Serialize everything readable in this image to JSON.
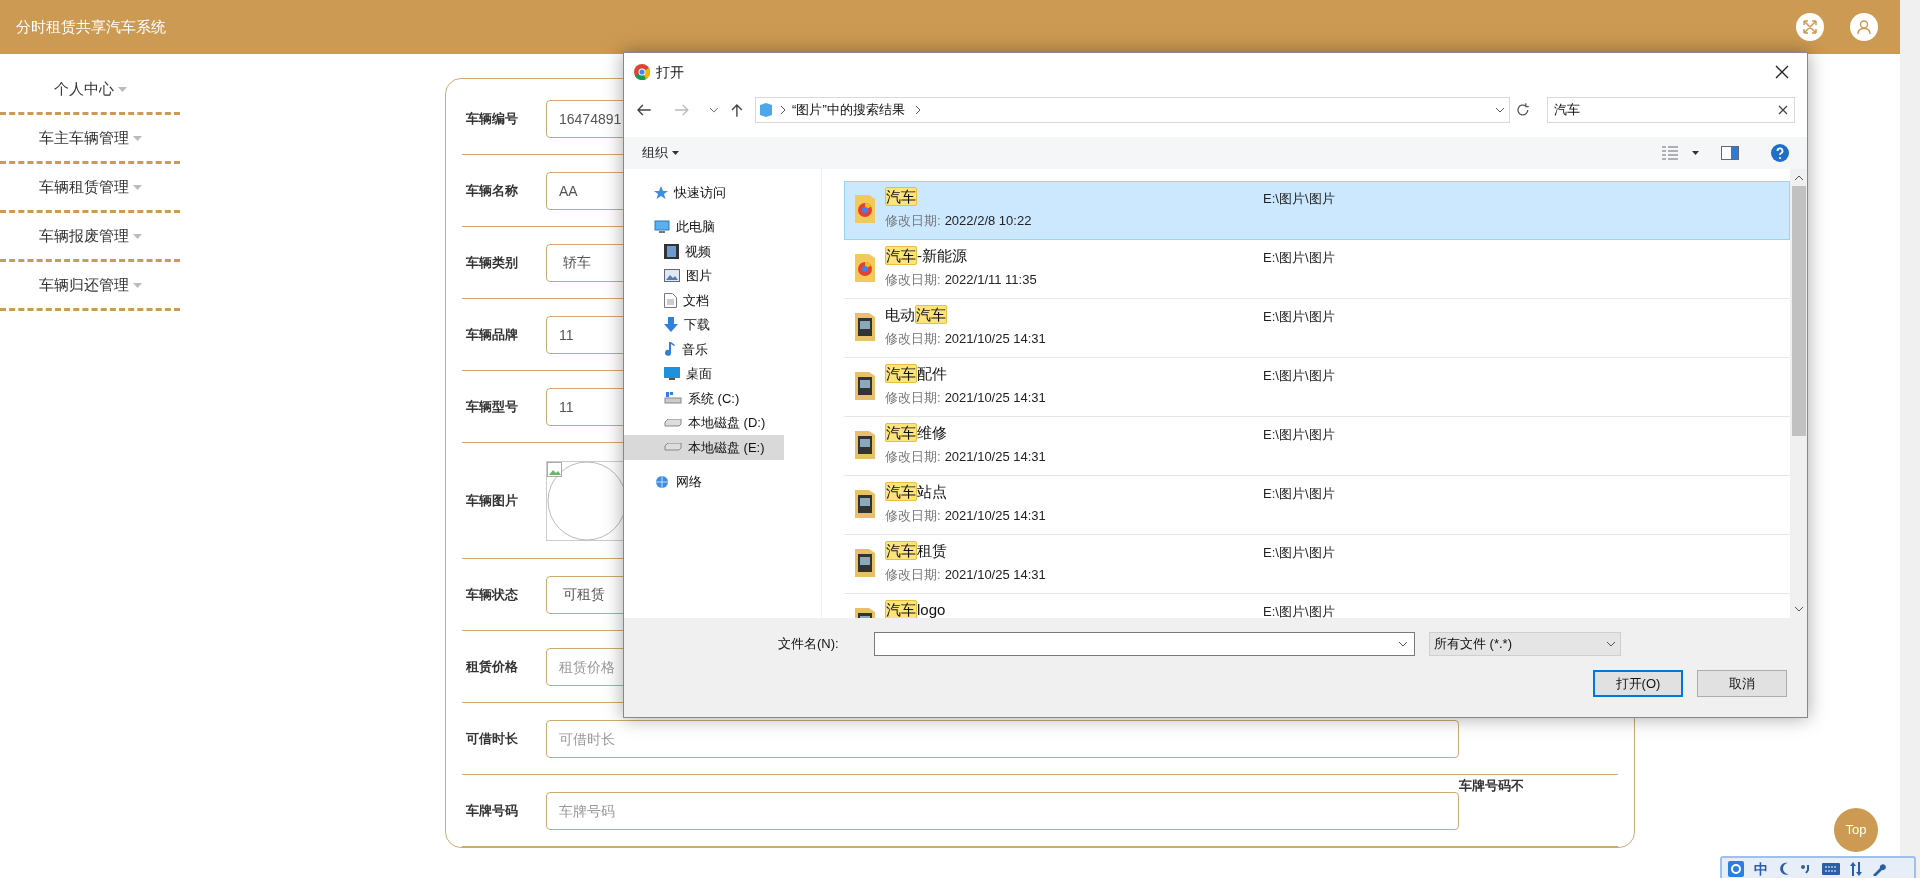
{
  "header": {
    "title": "分时租赁共享汽车系统"
  },
  "sidebar": {
    "items": [
      {
        "label": "个人中心"
      },
      {
        "label": "车主车辆管理"
      },
      {
        "label": "车辆租赁管理"
      },
      {
        "label": "车辆报废管理"
      },
      {
        "label": "车辆归还管理"
      }
    ]
  },
  "form": {
    "fields": [
      {
        "kind": "text",
        "label": "车辆编号",
        "value": "16474891"
      },
      {
        "kind": "text",
        "label": "车辆名称",
        "value": "AA"
      },
      {
        "kind": "select",
        "label": "车辆类别",
        "value": "轿车"
      },
      {
        "kind": "text",
        "label": "车辆品牌",
        "value": "11"
      },
      {
        "kind": "text",
        "label": "车辆型号",
        "value": "11"
      },
      {
        "kind": "image",
        "label": "车辆图片"
      },
      {
        "kind": "select",
        "label": "车辆状态",
        "value": "可租赁"
      },
      {
        "kind": "text",
        "label": "租赁价格",
        "placeholder": "租赁价格"
      },
      {
        "kind": "text",
        "label": "可借时长",
        "placeholder": "可借时长"
      },
      {
        "kind": "text",
        "label": "车牌号码",
        "placeholder": "车牌号码",
        "note": "车牌号码不"
      }
    ]
  },
  "top_button": "Top",
  "dialog": {
    "title": "打开",
    "address": "“图片”中的搜索结果",
    "search": "汽车",
    "organize": "组织",
    "nav": [
      {
        "label": "快速访问",
        "selected": false
      },
      {
        "label": "此电脑",
        "selected": false,
        "children": [
          {
            "label": "视频",
            "selected": false
          },
          {
            "label": "图片",
            "selected": false
          },
          {
            "label": "文档",
            "selected": false
          },
          {
            "label": "下载",
            "selected": false
          },
          {
            "label": "音乐",
            "selected": false
          },
          {
            "label": "桌面",
            "selected": false
          },
          {
            "label": "系统 (C:)",
            "selected": false
          },
          {
            "label": "本地磁盘 (D:)",
            "selected": false
          },
          {
            "label": "本地磁盘 (E:)",
            "selected": true
          }
        ]
      },
      {
        "label": "网络",
        "selected": false
      }
    ],
    "files": [
      {
        "kind": "app-folder",
        "match": "汽车",
        "date_label": "修改日期:",
        "date": "2022/2/8 10:22",
        "location": "E:\\图片\\图片",
        "selected": true
      },
      {
        "kind": "app-folder",
        "match": "汽车",
        "suffix": "-新能源",
        "date_label": "修改日期:",
        "date": "2022/1/11 11:35",
        "location": "E:\\图片\\图片",
        "selected": false
      },
      {
        "kind": "photo-folder",
        "prefix": "电动",
        "match": "汽车",
        "date_label": "修改日期:",
        "date": "2021/10/25 14:31",
        "location": "E:\\图片\\图片",
        "selected": false
      },
      {
        "kind": "photo-folder",
        "match": "汽车",
        "suffix": "配件",
        "date_label": "修改日期:",
        "date": "2021/10/25 14:31",
        "location": "E:\\图片\\图片",
        "selected": false
      },
      {
        "kind": "photo-folder",
        "match": "汽车",
        "suffix": "维修",
        "date_label": "修改日期:",
        "date": "2021/10/25 14:31",
        "location": "E:\\图片\\图片",
        "selected": false
      },
      {
        "kind": "photo-folder",
        "match": "汽车",
        "suffix": "站点",
        "date_label": "修改日期:",
        "date": "2021/10/25 14:31",
        "location": "E:\\图片\\图片",
        "selected": false
      },
      {
        "kind": "photo-folder",
        "match": "汽车",
        "suffix": "租赁",
        "date_label": "修改日期:",
        "date": "2021/10/25 14:31",
        "location": "E:\\图片\\图片",
        "selected": false
      },
      {
        "kind": "photo-folder",
        "match": "汽车",
        "suffix": "logo",
        "location": "E:\\图片\\图片",
        "selected": false
      }
    ],
    "filename_label": "文件名(N):",
    "filetype": "所有文件 (*.*)",
    "buttons": [
      "打开(O)",
      "取消"
    ]
  },
  "ime": {
    "mode": "中"
  }
}
